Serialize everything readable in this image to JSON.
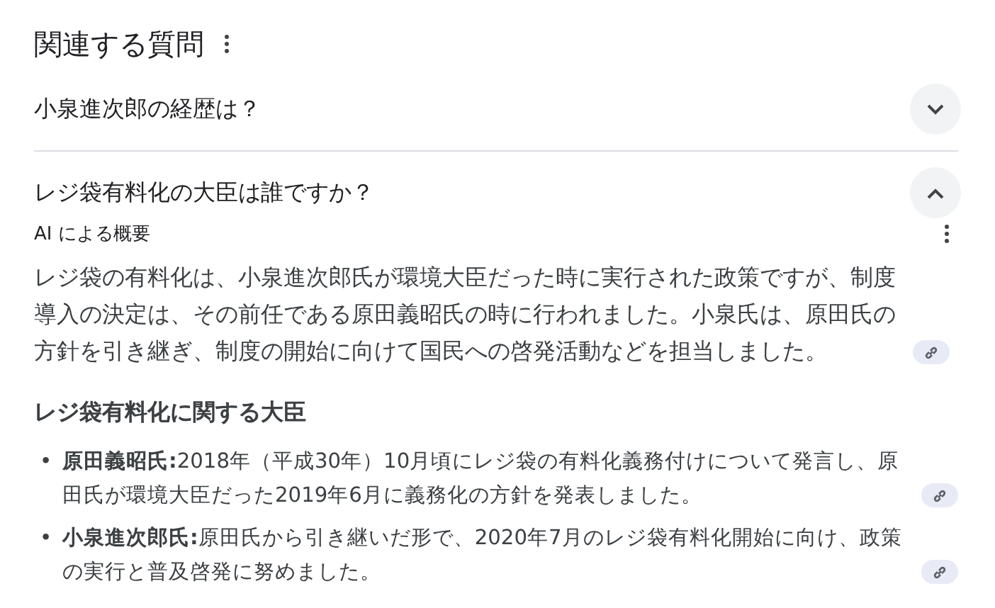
{
  "section_title": "関連する質問",
  "questions": [
    {
      "text": "小泉進次郎の経歴は？",
      "expanded": false
    },
    {
      "text": "レジ袋有料化の大臣は誰ですか？",
      "expanded": true,
      "answer": {
        "overview_label": "AI による概要",
        "paragraph": "レジ袋の有料化は、小泉進次郎氏が環境大臣だった時に実行された政策ですが、制度導入の決定は、その前任である原田義昭氏の時に行われました。小泉氏は、原田氏の方針を引き継ぎ、制度の開始に向けて国民への啓発活動などを担当しました。",
        "heading": "レジ袋有料化に関する大臣",
        "bullets": [
          {
            "marker": "•",
            "text": "**原田義昭氏:**2018年（平成30年）10月頃にレジ袋の有料化義務付けについて発言し、原田氏が環境大臣だった2019年6月に義務化の方針を発表しました。"
          },
          {
            "marker": "•",
            "text": "**小泉進次郎氏:**原田氏から引き継いだ形で、2020年7月のレジ袋有料化開始に向け、政策の実行と普及啓発に努めました。"
          }
        ]
      }
    }
  ]
}
